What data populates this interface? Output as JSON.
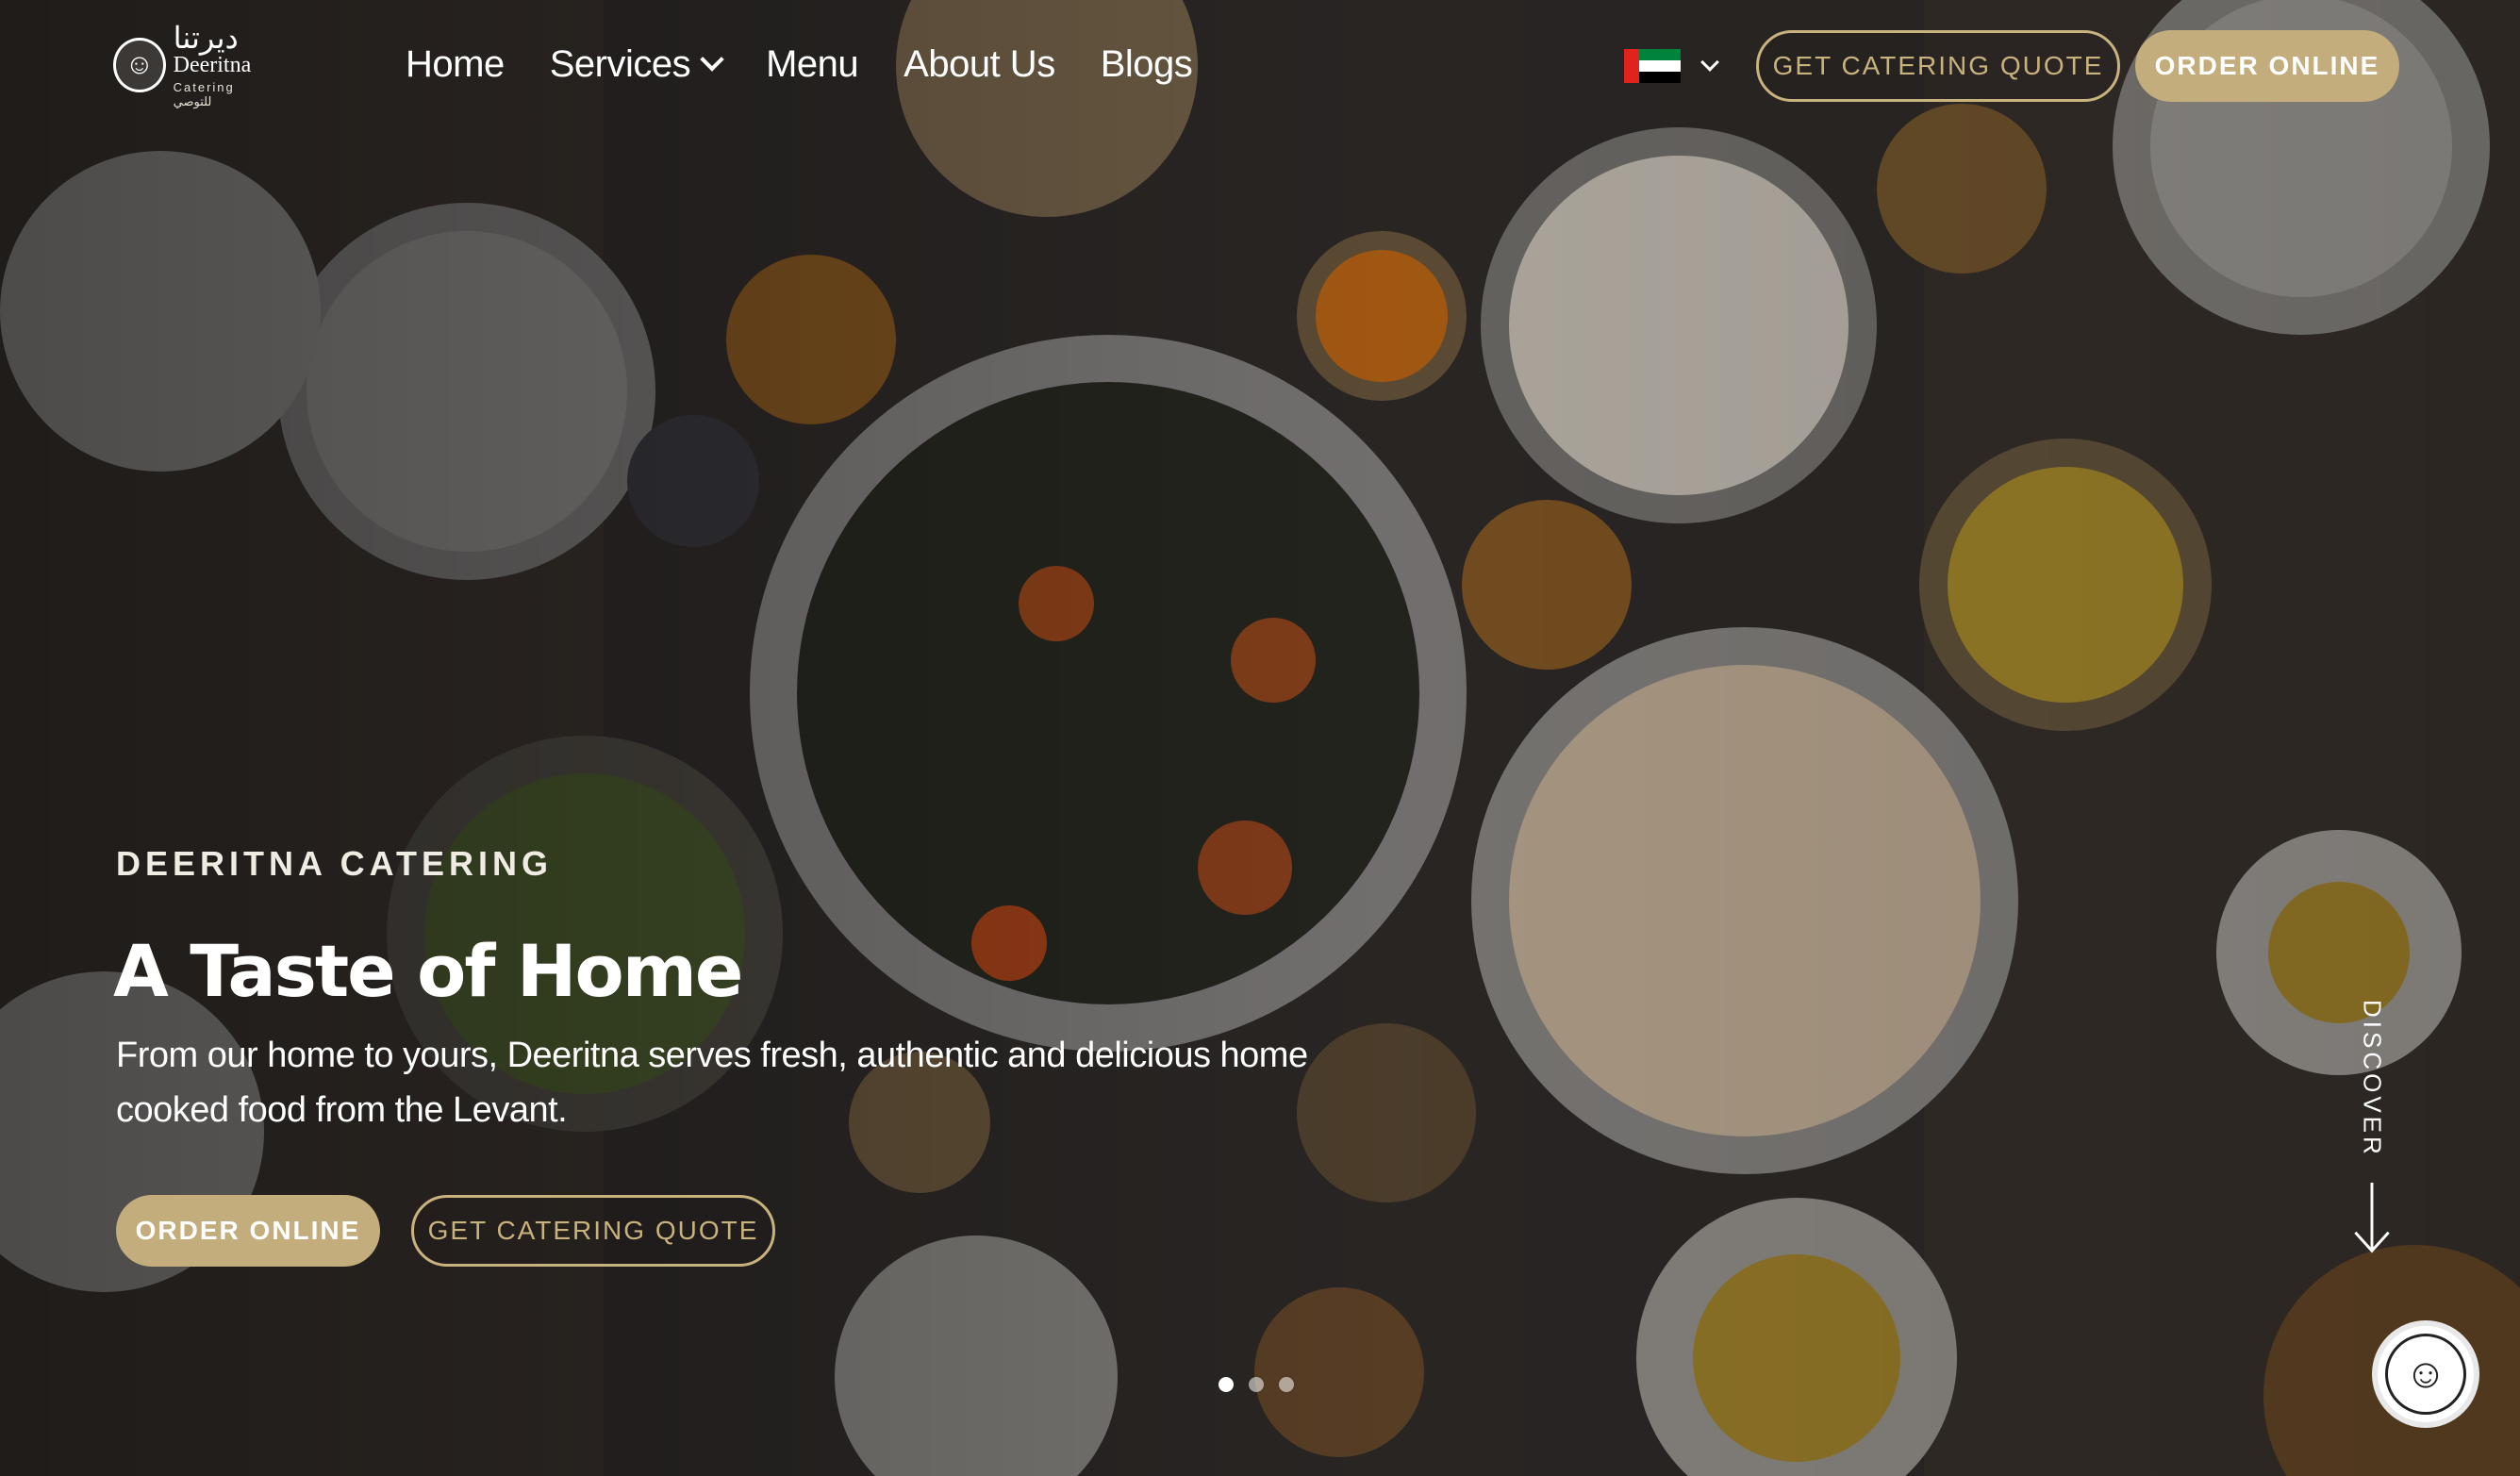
{
  "brand": {
    "arabic": "ديرتنا",
    "name": "Deeritna",
    "tagline": "Catering للتوصي",
    "logo_icon": "chef-portrait-icon"
  },
  "nav": {
    "items": [
      {
        "label": "Home"
      },
      {
        "label": "Services",
        "has_dropdown": true
      },
      {
        "label": "Menu"
      },
      {
        "label": "About Us"
      },
      {
        "label": "Blogs"
      }
    ]
  },
  "language": {
    "flag": "uae-flag-icon",
    "flag_colors": {
      "red": "#e0231d",
      "green": "#00843d",
      "white": "#ffffff",
      "black": "#000000"
    }
  },
  "header_buttons": {
    "quote_label": "GET CATERING QUOTE",
    "order_label": "ORDER ONLINE"
  },
  "hero": {
    "eyebrow": "DEERITNA CATERING",
    "title": "A Taste of Home",
    "description": "From our home to yours, Deeritna serves fresh, authentic and delicious home cooked food from the Levant.",
    "order_label": "ORDER ONLINE",
    "quote_label": "GET CATERING QUOTE"
  },
  "carousel": {
    "slides": 3,
    "active": 0
  },
  "discover": {
    "label": "DISCOVER",
    "icon": "arrow-down-icon"
  },
  "colors": {
    "accent": "#c4ad7c",
    "outline": "#c8b27e",
    "text": "#ffffff"
  }
}
